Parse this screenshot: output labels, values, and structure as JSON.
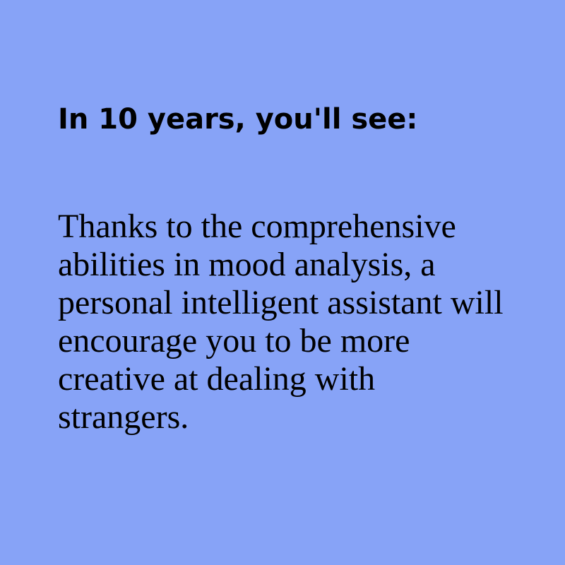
{
  "card": {
    "heading": "In 10 years, you'll see:",
    "body": "Thanks to the comprehensive abilities in mood analysis, a personal intelligent assistant will encourage you to be more creative at dealing with strangers.",
    "background_color": "#87a3f7",
    "text_color": "#000000"
  }
}
